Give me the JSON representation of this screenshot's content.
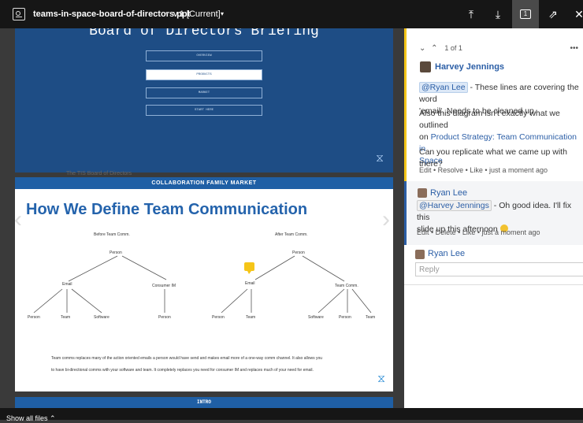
{
  "topbar": {
    "filename": "teams-in-space-board-of-directors.ppt",
    "separator": "•",
    "version": "v.1 [Current]",
    "caret": "▾",
    "upload_icon": "⤒",
    "download_icon": "⤓",
    "comment_count": "1",
    "share_icon": "⇗",
    "close_icon": "✕"
  },
  "slides": {
    "slide1": {
      "title": "Board of Directors Briefing",
      "buttons": [
        "OVERVIEW",
        "PRODUCTS",
        "MARKET",
        "START HERE"
      ]
    },
    "ghost_text": "The TIS Board of Directors",
    "slide2": {
      "band": "COLLABORATION FAMILY MARKET",
      "title": "How We Define Team Communication",
      "before_label": "Before Team Comm.",
      "after_label": "After Team Comm.",
      "nodes": {
        "person": "Person",
        "email": "Email",
        "consumer_im": "Consumer IM",
        "team_comm": "Team Comm.",
        "team": "Team",
        "software": "Software"
      },
      "body_line1": "Team comms replaces many of the action oriented emails a person would have send and makes email more of a one-way comm channel. It also allows you",
      "body_line2": "to have bi-directional comms with your software and team. It completely replaces you need for consumer IM and replaces much of your need for email."
    },
    "slide3": {
      "band": "INTRO"
    }
  },
  "bottombar": {
    "show_all": "Show all files ⌃"
  },
  "panel": {
    "nav": {
      "down": "⌄",
      "up": "⌃",
      "counter": "1 of 1",
      "more": "•••"
    },
    "comment1": {
      "author": "Harvey Jennings",
      "mention": "@Ryan Lee",
      "text1_rest": " - These lines are covering the word",
      "text1_line2": "'email'. Needs to be cleaned up.",
      "text2_a": "Also this diagram isn't exactly what we outlined",
      "text2_b": "on ",
      "text2_link1": "Product Strategy: Team Communication in",
      "text2_link2": "Space",
      "text3": "Can you replicate what we came up with there?",
      "actions": "Edit  •  Resolve  •  Like  •  just a moment ago"
    },
    "comment2": {
      "author": "Ryan Lee",
      "mention": "@Harvey Jennings",
      "text_rest": " - Oh good idea. I'll fix this",
      "text_line2": "slide up this afternoon ",
      "actions": "Edit  •  Delete  •  Like  •  just a moment ago"
    },
    "reply": {
      "author": "Ryan Lee",
      "placeholder": "Reply"
    }
  }
}
